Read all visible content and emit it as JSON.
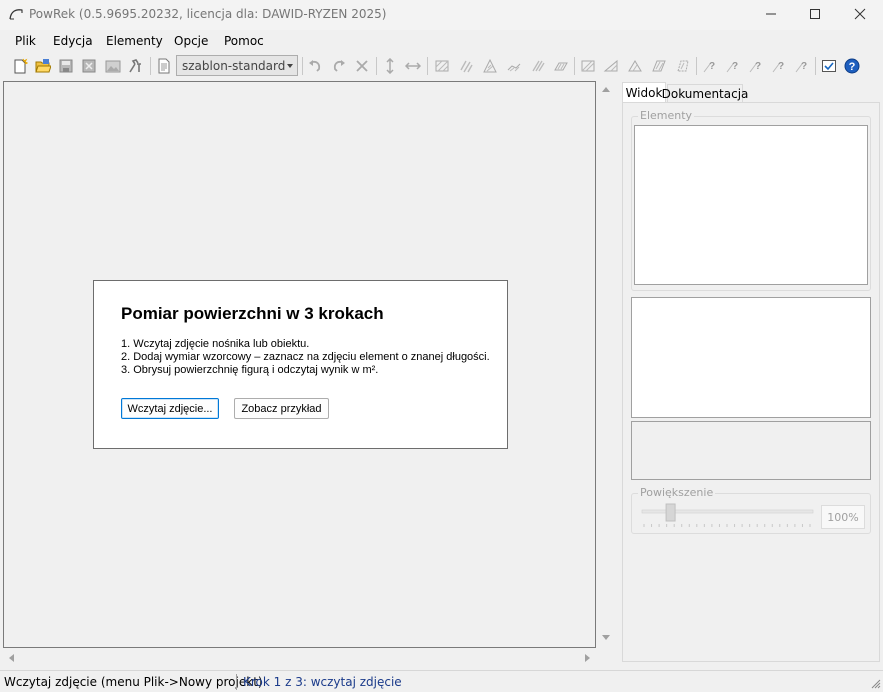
{
  "window": {
    "title": "PowRek (0.5.9695.20232, licencja dla: DAWID-RYZEN 2025)",
    "icons": {
      "app": "curve-icon",
      "minimize": "minimize-icon",
      "maximize": "maximize-icon",
      "close": "close-icon"
    }
  },
  "menu": {
    "items": [
      "Plik",
      "Edycja",
      "Elementy",
      "Opcje",
      "Pomoc"
    ]
  },
  "toolbar": {
    "template_select": {
      "value": "szablon-standard"
    },
    "icons": [
      "new-project-icon",
      "open-icon",
      "save-icon",
      "save-as-icon",
      "export-image-icon",
      "tools-icon",
      "document-icon",
      "undo-icon",
      "redo-icon",
      "delete-icon",
      "vertical-dimension-icon",
      "horizontal-dimension-icon",
      "hatch-rect-icon",
      "hatch-circle-icon",
      "hatch-triangle-icon",
      "hatch-ellipse-icon",
      "hatch-parallelogram-icon",
      "hatch-trapezoid-icon",
      "hatch-sector-icon",
      "hatch-segment-icon",
      "hatch-ring-icon",
      "hatch-polygon-icon",
      "help-area-1-icon",
      "help-area-2-icon",
      "help-area-3-icon",
      "help-area-4-icon",
      "help-area-5-icon",
      "checkbox-options-icon",
      "help-icon"
    ]
  },
  "intro": {
    "title": "Pomiar powierzchni w 3 krokach",
    "steps": [
      "1. Wczytaj zdjęcie nośnika lub obiektu.",
      "2. Dodaj wymiar wzorcowy – zaznacz na zdjęciu element o znanej długości.",
      "3. Obrysuj powierzchnię figurą i odczytaj wynik w m²."
    ],
    "load_button": "Wczytaj zdjęcie...",
    "example_button": "Zobacz przykład"
  },
  "side_panel": {
    "tabs": [
      "Widok",
      "Dokumentacja"
    ],
    "active_tab": "Widok",
    "elements_label": "Elementy",
    "zoom_label": "Powiększenie",
    "zoom_value": "100%",
    "zoom_level_percent": 16
  },
  "status": {
    "hint": "Wczytaj zdjęcie (menu Plik->Nowy projekt)",
    "step": "Krok 1 z 3: wczytaj zdjęcie"
  }
}
